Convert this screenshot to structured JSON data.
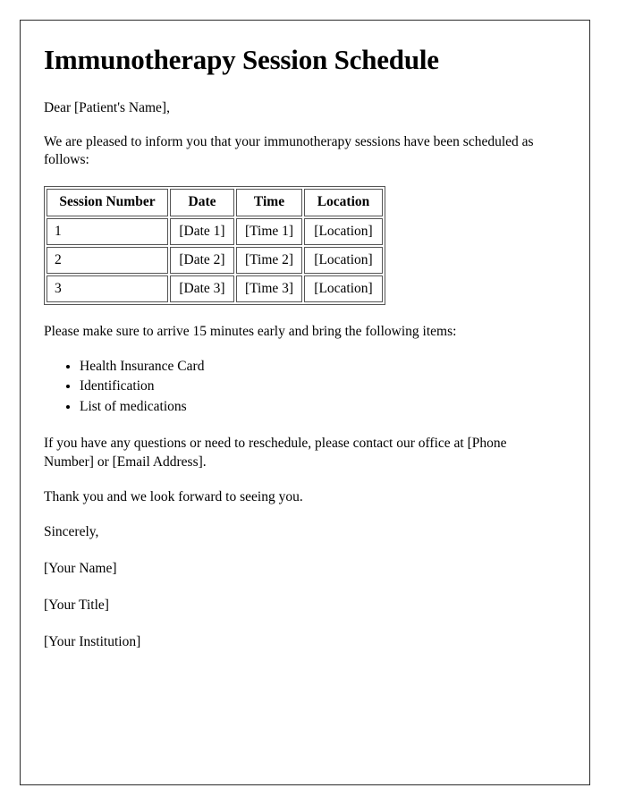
{
  "document": {
    "title": "Immunotherapy Session Schedule",
    "salutation": "Dear [Patient's Name],",
    "intro_paragraph": "We are pleased to inform you that your immunotherapy sessions have been scheduled as follows:",
    "table": {
      "headers": [
        "Session Number",
        "Date",
        "Time",
        "Location"
      ],
      "rows": [
        {
          "session": "1",
          "date": "[Date 1]",
          "time": "[Time 1]",
          "location": "[Location]"
        },
        {
          "session": "2",
          "date": "[Date 2]",
          "time": "[Time 2]",
          "location": "[Location]"
        },
        {
          "session": "3",
          "date": "[Date 3]",
          "time": "[Time 3]",
          "location": "[Location]"
        }
      ]
    },
    "instructions_paragraph": "Please make sure to arrive 15 minutes early and bring the following items:",
    "bring_items": [
      "Health Insurance Card",
      "Identification",
      "List of medications"
    ],
    "contact_paragraph": "If you have any questions or need to reschedule, please contact our office at [Phone Number] or [Email Address].",
    "closing_paragraph": "Thank you and we look forward to seeing you.",
    "signoff": "Sincerely,",
    "signature": {
      "name": "[Your Name]",
      "title": "[Your Title]",
      "institution": "[Your Institution]"
    }
  },
  "style": {
    "page_border_color": "#2b2b2b",
    "text_color": "#000000",
    "table_border_color": "#555555",
    "background": "#ffffff"
  }
}
